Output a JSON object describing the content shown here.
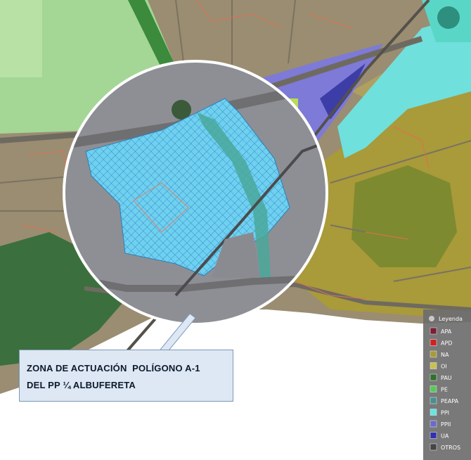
{
  "map": {
    "callout": {
      "line1": "ZONA DE ACTUACIÓN  POLÍGONO A-1",
      "line2": "DEL PP ¼ ALBUFERETA"
    },
    "legend": {
      "title": "Leyenda",
      "items": [
        {
          "code": "APA",
          "color": "#7a2035"
        },
        {
          "code": "APD",
          "color": "#d02020"
        },
        {
          "code": "NA",
          "color": "#a99a3a"
        },
        {
          "code": "OI",
          "color": "#c8c050"
        },
        {
          "code": "PAU",
          "color": "#2f6f2f"
        },
        {
          "code": "PE",
          "color": "#5ac85a"
        },
        {
          "code": "PEAPA",
          "color": "#4a8f8f"
        },
        {
          "code": "PPI",
          "color": "#66e6e0"
        },
        {
          "code": "PPII",
          "color": "#6a6ac8"
        },
        {
          "code": "UA",
          "color": "#3030b0"
        },
        {
          "code": "OTROS",
          "color": "#444444"
        }
      ]
    },
    "colors": {
      "urban": "#9a8d72",
      "na_zone": "#a99a3a",
      "pe_zone": "#9ed38a",
      "pau_zone": "#2f6f2f",
      "ppi_zone": "#66e6e0",
      "ppii_zone": "#7878d8",
      "hatch_zone": "#66c8f0",
      "sea": "#ffffff"
    }
  }
}
